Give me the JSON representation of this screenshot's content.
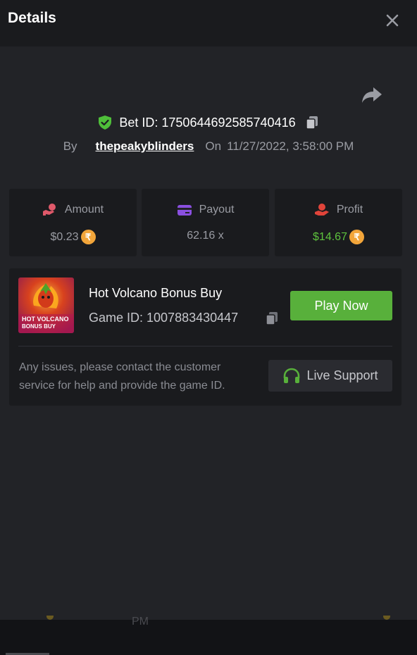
{
  "header": {
    "title": "Details"
  },
  "bet": {
    "id_label": "Bet ID: 1750644692585740416",
    "by_label": "By",
    "username": "thepeakyblinders",
    "on_label": "On",
    "datetime": "11/27/2022, 3:58:00 PM"
  },
  "cards": {
    "amount": {
      "label": "Amount",
      "value": "$0.23"
    },
    "payout": {
      "label": "Payout",
      "value": "62.16 x"
    },
    "profit": {
      "label": "Profit",
      "value": "$14.67"
    }
  },
  "currency_symbol": "₹",
  "game": {
    "thumb_text_line1": "HOT VOLCANO",
    "thumb_text_line2": "BONUS BUY",
    "name": "Hot Volcano Bonus Buy",
    "id_label": "Game ID: 1007883430447",
    "play_label": "Play Now"
  },
  "support": {
    "notice": "Any issues, please contact the customer service for help and provide the game ID.",
    "button_label": "Live Support"
  },
  "footer": {
    "peek_text": "PM"
  },
  "colors": {
    "accent_green": "#58b03b",
    "profit_green": "#5ec23d",
    "coin": "#f2a53a",
    "amount_icon": "#e0596a",
    "payout_icon": "#8a4fe0",
    "profit_icon": "#e0443a",
    "shield": "#4fbf3a"
  },
  "icons": [
    "close-icon",
    "share-icon",
    "shield-check-icon",
    "copy-icon",
    "coins-icon",
    "card-icon",
    "hand-coin-icon",
    "rupee-coin-icon",
    "headset-icon"
  ]
}
